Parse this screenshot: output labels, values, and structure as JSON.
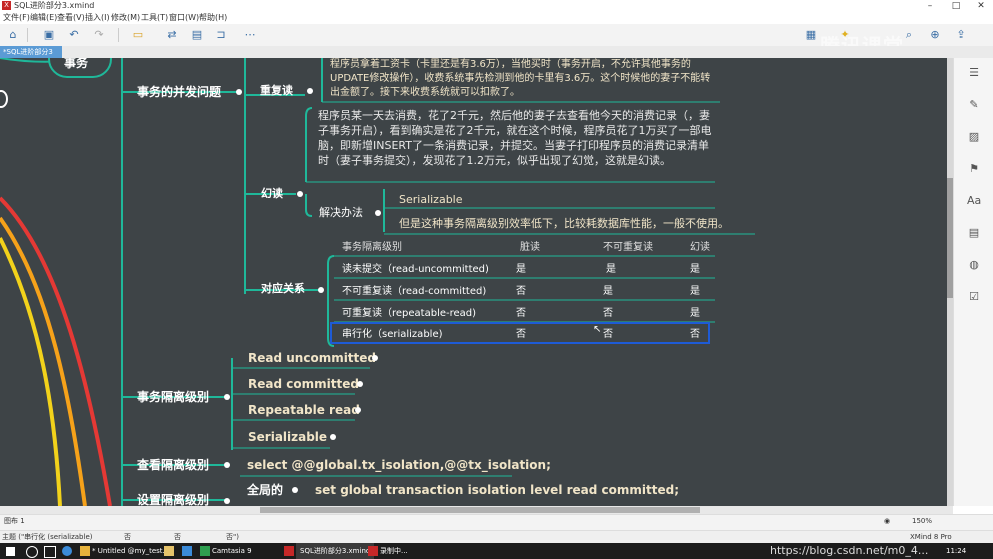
{
  "window": {
    "title": "SQL进阶部分3.xmind",
    "app_icon": "X",
    "minimize": "–",
    "maximize": "□",
    "close": "✕"
  },
  "menu": [
    "文件(F)",
    "编辑(E)",
    "查看(V)",
    "插入(I)",
    "修改(M)",
    "工具(T)",
    "窗口(W)",
    "帮助(H)"
  ],
  "tab": {
    "label": "*SQL进阶部分3",
    "close": "✕"
  },
  "watermark": "腾讯课堂",
  "map": {
    "root_partial": "事务",
    "concurrency": {
      "label": "事务的并发问题",
      "repeatable": {
        "label": "重复读",
        "text": "程序员拿着工资卡（卡里还是有3.6万），当他买时（事务开启，不允许其他事务的UPDATE修改操作），收费系统事先检测到他的卡里有3.6万。这个时候他的妻子不能转出金额了。接下来收费系统就可以扣款了。"
      },
      "phantom": {
        "label": "幻读",
        "text": "程序员某一天去消费，花了2千元，然后他的妻子去查看他今天的消费记录（，妻子事务开启），看到确实是花了2千元，就在这个时候，程序员花了1万买了一部电脑，即新增INSERT了一条消费记录，并提交。当妻子打印程序员的消费记录清单时（妻子事务提交），发现花了1.2万元，似乎出现了幻觉，这就是幻读。",
        "solution_label": "解决办法",
        "solution_title": "Serializable",
        "solution_note": "但是这种事务隔离级别效率低下，比较耗数据库性能，一般不使用。"
      },
      "relation": {
        "label": "对应关系",
        "headers": [
          "事务隔离级别",
          "脏读",
          "不可重复读",
          "幻读"
        ],
        "rows": [
          [
            "读未提交（read-uncommitted)",
            "是",
            "是",
            "是"
          ],
          [
            "不可重复读（read-committed)",
            "否",
            "是",
            "是"
          ],
          [
            "可重复读（repeatable-read)",
            "否",
            "否",
            "是"
          ],
          [
            "串行化（serializable)",
            "否",
            "否",
            "否"
          ]
        ]
      }
    },
    "isolation": {
      "label": "事务隔离级别",
      "levels": [
        "Read uncommitted",
        "Read committed",
        "Repeatable read",
        "Serializable"
      ]
    },
    "view_level": {
      "label": "查看隔离级别",
      "sql": "select @@global.tx_isolation,@@tx_isolation;"
    },
    "set_level": {
      "label": "设置隔离级别",
      "scope": "全局的",
      "sql": "set global transaction isolation level read committed;"
    }
  },
  "statusbar": {
    "sheet": "图布 1",
    "zoom": "150%"
  },
  "statusbar2": {
    "topic": "主题 (\"串行化 (serializable)",
    "c1": "否",
    "c2": "否",
    "c3": "否\")",
    "right": "XMind 8 Pro"
  },
  "taskbar": {
    "items": [
      "* Untitled @my_test...",
      "Camtasia 9",
      "SQL进阶部分3.xmind",
      "录制中..."
    ],
    "url": "https://blog.csdn.net/m0_4...",
    "time": "11:24"
  },
  "colors": {
    "canvas": "#3e4447",
    "branch_teal": "#1fb89a",
    "highlight": "#1e5bd6",
    "cream": "#f1e5c8"
  }
}
